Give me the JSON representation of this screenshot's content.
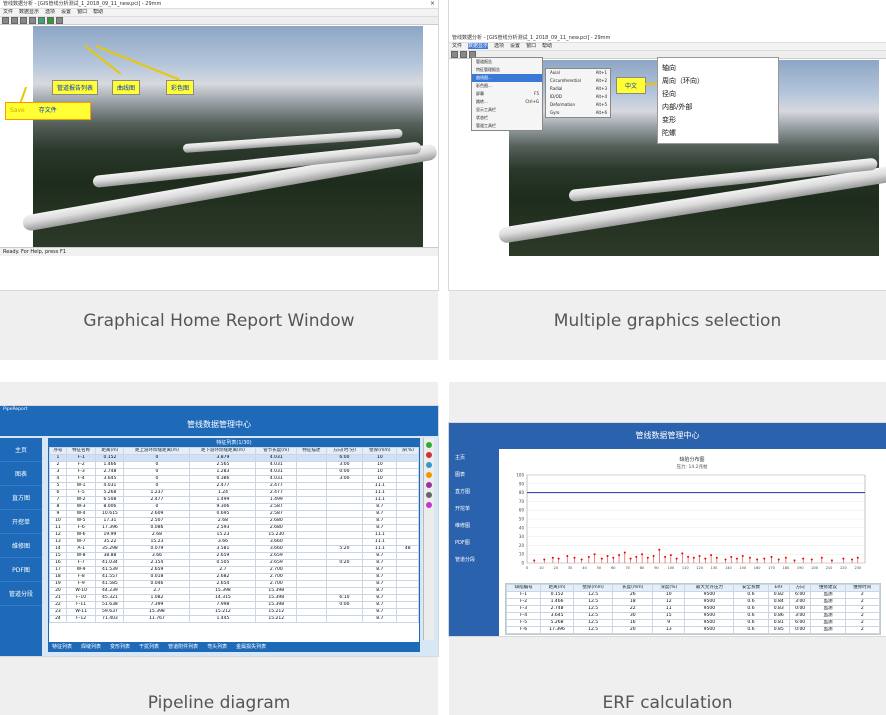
{
  "panels": [
    {
      "caption": "Graphical Home Report Window",
      "titlebar": "管线数据分析 - [GIS管线分析测试_1_2018_09_11_new.pci] - 29mm",
      "menu": [
        "文件",
        "数据显示",
        "选项",
        "设置",
        "窗口",
        "帮助"
      ],
      "labels": {
        "pipeline_report": "管道报告列表",
        "curve_chart": "曲线图",
        "color_chart": "彩色图",
        "save_en": "Save",
        "save_cn": "存文件"
      },
      "status": "Ready. For Help, press F1"
    },
    {
      "caption": "Multiple graphics selection",
      "titlebar": "管线数据分析 - [GIS管线分析测试_1_2018_09_11_new.pci] - 29mm",
      "menu": [
        "文件",
        "数据显示",
        "选项",
        "设置",
        "窗口",
        "帮助"
      ],
      "menu1": [
        {
          "label": "管道报告",
          "shortcut": ""
        },
        {
          "label": "特征管理报告",
          "shortcut": ""
        },
        {
          "label": "曲线图...",
          "shortcut": ""
        },
        {
          "label": "彩色图...",
          "shortcut": ""
        },
        {
          "label": "屏幕",
          "shortcut": "F5"
        },
        {
          "label": "跳转...",
          "shortcut": "Ctrl+G"
        },
        {
          "label": "显示工具栏",
          "shortcut": ""
        },
        {
          "label": "状态栏",
          "shortcut": ""
        },
        {
          "label": "管道工具栏",
          "shortcut": ""
        }
      ],
      "menu2": [
        {
          "label": "Axial",
          "shortcut": "Alt+1"
        },
        {
          "label": "Circumferential",
          "shortcut": "Alt+2"
        },
        {
          "label": "Radial",
          "shortcut": "Alt+3"
        },
        {
          "label": "ID/OD",
          "shortcut": "Alt+4"
        },
        {
          "label": "Deformation",
          "shortcut": "Alt+5"
        },
        {
          "label": "Gyro",
          "shortcut": "Alt+6"
        }
      ],
      "chinese_tag": "中文",
      "list": [
        "轴向",
        "周向（环向）",
        "径向",
        "内部/外部",
        "变形",
        "陀螺"
      ]
    },
    {
      "caption": "Pipeline diagram",
      "window_title": "PipeReport",
      "header": "管线数据管理中心",
      "subheader": "特征列表(1/30)",
      "sidebar": [
        "主页",
        "图表",
        "直方图",
        "开挖单",
        "维修图",
        "PDF图",
        "管道分段"
      ],
      "columns": [
        "序号",
        "特征名称",
        "距离(m)",
        "距上游环焊缝距离(m)",
        "距下游环焊缝距离(m)",
        "管节长度(m)",
        "特征描述",
        "方向(时:分)",
        "壁厚(mm)",
        "深(%)"
      ],
      "rows": [
        [
          "1",
          "F-1",
          "0.152",
          "0",
          "3.879",
          "4.031",
          "",
          "6:00",
          "10",
          ""
        ],
        [
          "2",
          "F-2",
          "1.466",
          "0",
          "2.565",
          "4.031",
          "",
          "3:00",
          "10",
          ""
        ],
        [
          "3",
          "F-3",
          "2.748",
          "0",
          "1.283",
          "4.031",
          "",
          "0:00",
          "10",
          ""
        ],
        [
          "4",
          "F-4",
          "3.645",
          "0",
          "0.386",
          "4.031",
          "",
          "3:00",
          "10",
          ""
        ],
        [
          "5",
          "W-1",
          "4.031",
          "0",
          "2.477",
          "2.477",
          "",
          "",
          "11.1",
          ""
        ],
        [
          "6",
          "F-5",
          "5.268",
          "1.237",
          "1.24",
          "2.477",
          "",
          "",
          "11.1",
          ""
        ],
        [
          "7",
          "W-2",
          "6.508",
          "2.477",
          "1.499",
          "1.499",
          "",
          "",
          "11.1",
          ""
        ],
        [
          "8",
          "W-3",
          "8.006",
          "0",
          "9.306",
          "2.587",
          "",
          "",
          "8.7",
          ""
        ],
        [
          "9",
          "W-4",
          "10.615",
          "2.609",
          "0.695",
          "2.587",
          "",
          "",
          "8.7",
          ""
        ],
        [
          "10",
          "W-5",
          "17.31",
          "2.507",
          "2.68",
          "2.680",
          "",
          "",
          "8.7",
          ""
        ],
        [
          "11",
          "F-6",
          "17.396",
          "0.086",
          "2.593",
          "2.680",
          "",
          "",
          "8.7",
          ""
        ],
        [
          "12",
          "W-6",
          "19.99",
          "2.68",
          "15.23",
          "15.230",
          "",
          "",
          "11.1",
          ""
        ],
        [
          "13",
          "W-7",
          "35.22",
          "15.23",
          "3.66",
          "3.660",
          "",
          "",
          "11.1",
          ""
        ],
        [
          "14",
          "A-1",
          "35.298",
          "0.079",
          "3.581",
          "3.660",
          "",
          "5:20",
          "11.1",
          "48"
        ],
        [
          "15",
          "W-8",
          "38.88",
          "3.66",
          "2.659",
          "2.659",
          "",
          "",
          "8.7",
          ""
        ],
        [
          "16",
          "F-7",
          "41.034",
          "2.154",
          "0.505",
          "2.659",
          "",
          "0:20",
          "8.7",
          ""
        ],
        [
          "17",
          "W-9",
          "41.539",
          "2.659",
          "2.7",
          "2.700",
          "",
          "",
          "8.7",
          ""
        ],
        [
          "18",
          "F-8",
          "41.557",
          "0.018",
          "2.682",
          "2.700",
          "",
          "",
          "8.7",
          ""
        ],
        [
          "19",
          "F-9",
          "41.585",
          "0.046",
          "2.654",
          "2.700",
          "",
          "",
          "8.7",
          ""
        ],
        [
          "20",
          "W-10",
          "44.239",
          "2.7",
          "15.398",
          "15.398",
          "",
          "",
          "8.7",
          ""
        ],
        [
          "21",
          "F-10",
          "45.321",
          "1.082",
          "14.315",
          "15.398",
          "",
          "6:10",
          "8.7",
          ""
        ],
        [
          "22",
          "F-11",
          "51.638",
          "7.399",
          "7.998",
          "15.398",
          "",
          "0:00",
          "8.7",
          ""
        ],
        [
          "23",
          "W-11",
          "59.637",
          "15.398",
          "15.212",
          "15.212",
          "",
          "",
          "8.7",
          ""
        ],
        [
          "24",
          "F-12",
          "71.403",
          "11.767",
          "1.445",
          "15.212",
          "",
          "",
          "8.7",
          ""
        ]
      ],
      "bottom_tabs": [
        "特征列表",
        "焊缝列表",
        "变形列表",
        "干扰列表",
        "管道附件列表",
        "弯头列表",
        "金属损失列表"
      ]
    },
    {
      "caption": "ERF calculation",
      "header": "管线数据管理中心",
      "sidebar": [
        "主页",
        "图表",
        "直方图",
        "开挖单",
        "维修图",
        "PDF图",
        "管道分段"
      ],
      "chart_title": "缺陷分布图",
      "chart_subtitle": "压力: 14.2兆帕",
      "y_ticks": [
        "100",
        "90",
        "80",
        "70",
        "60",
        "50",
        "40",
        "30",
        "20",
        "10",
        "0"
      ],
      "x_ticks": [
        "0",
        "10",
        "20",
        "30",
        "40",
        "50",
        "60",
        "70",
        "80",
        "90",
        "100",
        "110",
        "120",
        "130",
        "140",
        "150",
        "160",
        "170",
        "180",
        "190",
        "200",
        "210",
        "220",
        "230"
      ],
      "columns": [
        "缺陷编号",
        "距离(m)",
        "壁厚(mm)",
        "长度(mm)",
        "深度(%)",
        "最大允许压力",
        "安全系数",
        "ERF",
        "方向",
        "维修建议",
        "维修时间"
      ],
      "rows": [
        [
          "F-1",
          "0.152",
          "12.5",
          "26",
          "10",
          "9500",
          "0.6",
          "0.82",
          "6:00",
          "监测",
          "2"
        ],
        [
          "F-2",
          "1.466",
          "12.5",
          "18",
          "12",
          "9500",
          "0.6",
          "0.84",
          "3:00",
          "监测",
          "2"
        ],
        [
          "F-3",
          "2.748",
          "12.5",
          "22",
          "11",
          "9500",
          "0.6",
          "0.83",
          "0:00",
          "监测",
          "2"
        ],
        [
          "F-4",
          "3.645",
          "12.5",
          "30",
          "15",
          "9500",
          "0.6",
          "0.86",
          "3:00",
          "监测",
          "2"
        ],
        [
          "F-5",
          "5.268",
          "12.5",
          "16",
          "9",
          "9500",
          "0.6",
          "0.81",
          "6:00",
          "监测",
          "2"
        ],
        [
          "F-6",
          "17.396",
          "12.5",
          "20",
          "13",
          "9500",
          "0.6",
          "0.85",
          "0:00",
          "监测",
          "2"
        ],
        [
          "F-7",
          "41.034",
          "12.5",
          "24",
          "8",
          "9500",
          "0.6",
          "0.80",
          "0:20",
          "监测",
          "2"
        ]
      ]
    }
  ],
  "chart_data": {
    "type": "scatter",
    "title": "缺陷分布图",
    "subtitle": "压力: 14.2兆帕",
    "xlim": [
      0,
      235
    ],
    "ylim": [
      0,
      100
    ],
    "reference_line": 80,
    "points": [
      [
        5,
        3
      ],
      [
        12,
        4
      ],
      [
        18,
        6
      ],
      [
        22,
        5
      ],
      [
        28,
        8
      ],
      [
        33,
        6
      ],
      [
        38,
        4
      ],
      [
        43,
        7
      ],
      [
        47,
        10
      ],
      [
        52,
        5
      ],
      [
        56,
        8
      ],
      [
        60,
        6
      ],
      [
        64,
        9
      ],
      [
        68,
        12
      ],
      [
        72,
        5
      ],
      [
        76,
        7
      ],
      [
        80,
        10
      ],
      [
        84,
        6
      ],
      [
        88,
        8
      ],
      [
        92,
        15
      ],
      [
        96,
        7
      ],
      [
        100,
        9
      ],
      [
        104,
        5
      ],
      [
        108,
        11
      ],
      [
        112,
        7
      ],
      [
        116,
        6
      ],
      [
        120,
        8
      ],
      [
        124,
        5
      ],
      [
        128,
        9
      ],
      [
        132,
        6
      ],
      [
        138,
        4
      ],
      [
        142,
        7
      ],
      [
        146,
        5
      ],
      [
        150,
        8
      ],
      [
        155,
        6
      ],
      [
        160,
        4
      ],
      [
        165,
        5
      ],
      [
        170,
        7
      ],
      [
        175,
        4
      ],
      [
        180,
        6
      ],
      [
        186,
        3
      ],
      [
        192,
        5
      ],
      [
        198,
        4
      ],
      [
        205,
        6
      ],
      [
        212,
        3
      ],
      [
        220,
        5
      ],
      [
        226,
        4
      ],
      [
        230,
        6
      ]
    ]
  }
}
